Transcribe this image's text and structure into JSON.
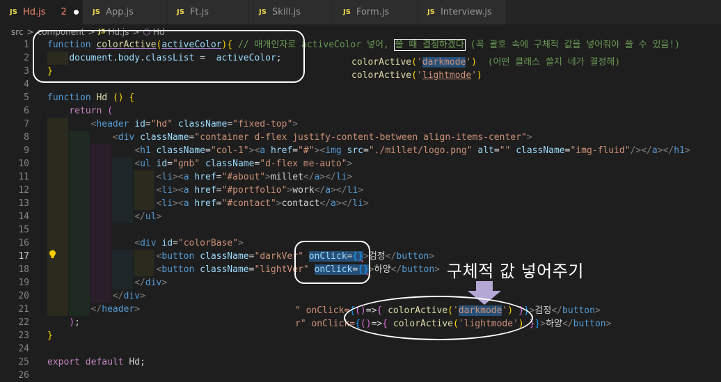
{
  "tabs": [
    {
      "icon": "JS",
      "label": "Hd.js",
      "count": "2",
      "active": true
    },
    {
      "icon": "JS",
      "label": "App.js"
    },
    {
      "icon": "JS",
      "label": "Ft.js"
    },
    {
      "icon": "JS",
      "label": "Skill.js"
    },
    {
      "icon": "JS",
      "label": "Form.js"
    },
    {
      "icon": "JS",
      "label": "Interview.js"
    }
  ],
  "breadcrumb": {
    "parts": [
      "src",
      "component"
    ],
    "file_icon": "JS",
    "file": "Hd.js",
    "symbol_icon": "cube-icon",
    "symbol": "Hd",
    "sep": ">"
  },
  "line_numbers": [
    "1",
    "2",
    "3",
    "4",
    "5",
    "6",
    "7",
    "8",
    "9",
    "10",
    "11",
    "12",
    "13",
    "14",
    "15",
    "16",
    "17",
    "18",
    "19",
    "20",
    "21",
    "22",
    "23",
    "24",
    "25",
    "26"
  ],
  "code": {
    "l1_function": "function",
    "l1_name": "colorActive",
    "l1_param": "activeColor",
    "l1_comment_a": "// 매개인자로 activeColor 넣어,",
    "l1_comment_b": "쓸 때 결정하겠다",
    "l1_comment_c": "(꼭 괄호 속에 구체적 값을 넣어줘야 쓸 수 있음!)",
    "l2_document": "document",
    "l2_body": "body",
    "l2_classList": "classList",
    "l2_value": "activeColor",
    "l6_function": "function",
    "l6_name": "Hd",
    "l7_return": "return",
    "l8_header": "header",
    "l8_id": "hd",
    "l8_class": "fixed-top",
    "l9_div_class": "container d-flex justify-content-between align-items-center",
    "l10_h1_class": "col-1",
    "l10_href": "#",
    "l10_src": "./millet/logo.png",
    "l10_alt": "",
    "l10_img_class": "img-fluid",
    "l11_ul_id": "gnb",
    "l11_ul_class": "d-flex me-auto",
    "l12_href": "#about",
    "l12_text": "millet",
    "l13_href": "#portfolio",
    "l13_text": "work",
    "l14_href": "#contact",
    "l14_text": "contact",
    "l17_div_id": "colorBase",
    "l18_class": "darkVer",
    "l18_text": "검정",
    "l19_class": "lightVer",
    "l19_text": "하양",
    "l25_export": "export",
    "l25_default": "default",
    "l25_name": "Hd",
    "attr_id": "id",
    "attr_className": "className",
    "attr_href": "href",
    "attr_src": "src",
    "attr_alt": "alt",
    "attr_onClick": "onClick",
    "tag_div": "div",
    "tag_h1": "h1",
    "tag_a": "a",
    "tag_img": "img",
    "tag_ul": "ul",
    "tag_li": "li",
    "tag_button": "button"
  },
  "annotations": {
    "call_dark": "colorActive",
    "call_dark_arg": "darkmode",
    "call_light": "colorActive",
    "call_light_arg": "lightmode",
    "hint_note": "(어떤 클래스 쓸지 네가 결정해)",
    "big_label": "구체적 값 넣어주기",
    "ex1_prefix": "\" onClick=",
    "ex1_func": "colorActive",
    "ex1_arg": "darkmode",
    "ex1_text": "검정",
    "ex2_prefix": "r\" onClick=",
    "ex2_func": "colorActive",
    "ex2_arg": "lightmode",
    "ex2_text": "하양",
    "close_button": "button"
  },
  "colors": {
    "annotation_box": "#ffffff",
    "arrow": "#b4a7d6",
    "highlight": "#264f78"
  }
}
